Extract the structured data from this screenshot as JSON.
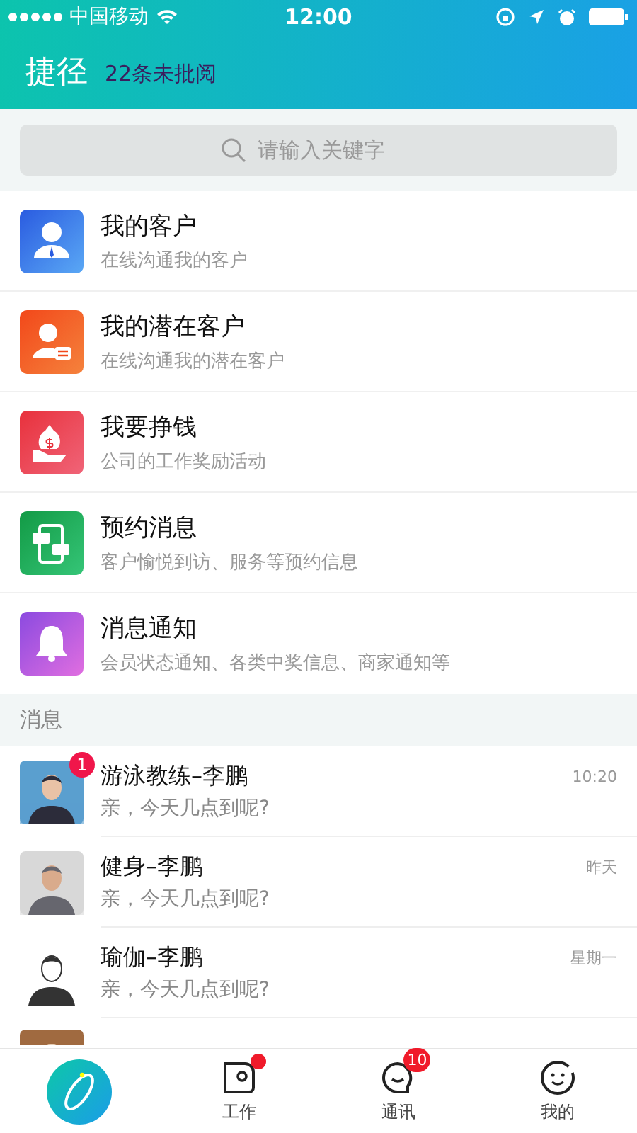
{
  "status_bar": {
    "carrier": "中国移动",
    "time": "12:00"
  },
  "header": {
    "title": "捷径",
    "subtitle": "22条未批阅"
  },
  "search": {
    "placeholder": "请输入关键字"
  },
  "shortcuts": [
    {
      "kind": "customer",
      "title": "我的客户",
      "subtitle": "在线沟通我的客户"
    },
    {
      "kind": "prospect",
      "title": "我的潜在客户",
      "subtitle": "在线沟通我的潜在客户"
    },
    {
      "kind": "money",
      "title": "我要挣钱",
      "subtitle": "公司的工作奖励活动"
    },
    {
      "kind": "appointment",
      "title": "预约消息",
      "subtitle": "客户愉悦到访、服务等预约信息"
    },
    {
      "kind": "bell",
      "title": "消息通知",
      "subtitle": "会员状态通知、各类中奖信息、商家通知等"
    }
  ],
  "messages_section": {
    "title": "消息"
  },
  "messages": [
    {
      "name": "游泳教练–李鹏",
      "preview": "亲，今天几点到呢?",
      "time": "10:20",
      "badge": "1"
    },
    {
      "name": "健身–李鹏",
      "preview": "亲，今天几点到呢?",
      "time": "昨天"
    },
    {
      "name": "瑜伽–李鹏",
      "preview": "亲，今天几点到呢?",
      "time": "星期一"
    },
    {
      "kind": "picture"
    }
  ],
  "tab_bar": [
    {
      "kind": "logo"
    },
    {
      "kind": "work",
      "label": "工作",
      "dot": true
    },
    {
      "kind": "contacts",
      "label": "通讯",
      "badge": "10"
    },
    {
      "kind": "me",
      "label": "我的"
    }
  ]
}
